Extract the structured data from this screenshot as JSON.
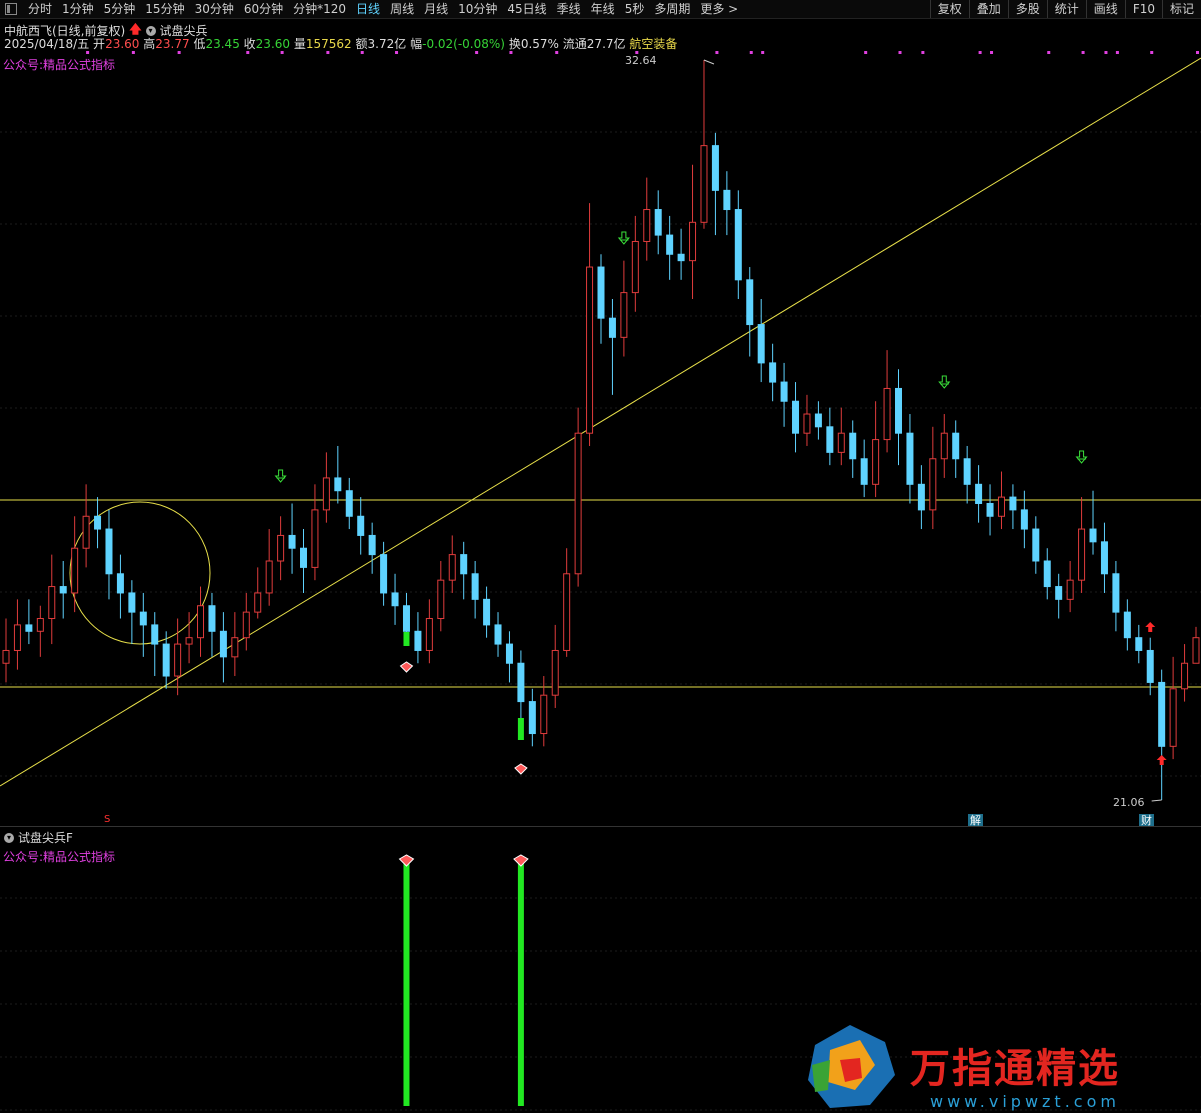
{
  "toolbar": {
    "tabs": [
      "分时",
      "1分钟",
      "5分钟",
      "15分钟",
      "30分钟",
      "60分钟",
      "分钟*120",
      "日线",
      "周线",
      "月线",
      "10分钟",
      "45日线",
      "季线",
      "年线",
      "5秒",
      "多周期",
      "更多 >"
    ],
    "active_index": 7,
    "right_buttons": [
      "复权",
      "叠加",
      "多股",
      "统计",
      "画线",
      "F10",
      "标记"
    ]
  },
  "header": {
    "stock_title": "中航西飞(日线,前复权)",
    "indicator_name": "试盘尖兵"
  },
  "quote": {
    "date": "2025/04/18/五",
    "open_label": "开",
    "open": "23.60",
    "high_label": "高",
    "high": "23.77",
    "low_label": "低",
    "low": "23.45",
    "close_label": "收",
    "close": "23.60",
    "volume_label": "量",
    "volume": "157562",
    "amount_label": "额",
    "amount": "3.72亿",
    "change_label": "幅",
    "change": "-0.02(-0.08%)",
    "turnover_label": "换",
    "turnover": "0.57%",
    "float_label": "流通",
    "float": "27.7亿",
    "sector": "航空装备"
  },
  "main_panel": {
    "formula_label": "公众号:精品公式指标",
    "high_price_label": "32.64",
    "low_price_label": "21.06",
    "badge_jie": "解",
    "badge_cai": "财",
    "s_marker": "S"
  },
  "sub_panel": {
    "title": "试盘尖兵F",
    "formula_label": "公众号:精品公式指标"
  },
  "watermark": {
    "title": "万指通精选",
    "url": "www.vipwzt.com"
  },
  "colors": {
    "up": "#e03c3c",
    "down": "#5fd3ff",
    "trend_line": "#e8e04a",
    "signal_green": "#22e822",
    "marker_magenta": "#e040e0"
  },
  "chart_data": {
    "type": "candlestick",
    "price_range": [
      21.06,
      32.64
    ],
    "candles": [
      [
        23.2,
        23.4,
        23.9,
        22.9
      ],
      [
        23.4,
        23.8,
        24.2,
        23.1
      ],
      [
        23.8,
        23.7,
        24.2,
        23.5
      ],
      [
        23.7,
        23.9,
        24.1,
        23.3
      ],
      [
        23.9,
        24.4,
        24.9,
        23.5
      ],
      [
        24.4,
        24.3,
        24.8,
        23.9
      ],
      [
        24.3,
        25.0,
        25.5,
        24.0
      ],
      [
        25.0,
        25.5,
        26.0,
        24.7
      ],
      [
        25.5,
        25.3,
        25.8,
        25.0
      ],
      [
        25.3,
        24.6,
        25.6,
        24.2
      ],
      [
        24.6,
        24.3,
        24.9,
        23.9
      ],
      [
        24.3,
        24.0,
        24.5,
        23.5
      ],
      [
        24.0,
        23.8,
        24.3,
        23.3
      ],
      [
        23.8,
        23.5,
        24.0,
        23.0
      ],
      [
        23.5,
        23.0,
        23.7,
        22.8
      ],
      [
        23.0,
        23.5,
        23.9,
        22.7
      ],
      [
        23.5,
        23.6,
        24.0,
        23.2
      ],
      [
        23.6,
        24.1,
        24.4,
        23.3
      ],
      [
        24.1,
        23.7,
        24.3,
        23.3
      ],
      [
        23.7,
        23.3,
        24.0,
        22.9
      ],
      [
        23.3,
        23.6,
        24.0,
        23.0
      ],
      [
        23.6,
        24.0,
        24.3,
        23.4
      ],
      [
        24.0,
        24.3,
        24.7,
        23.9
      ],
      [
        24.3,
        24.8,
        25.3,
        24.1
      ],
      [
        24.8,
        25.2,
        25.5,
        24.5
      ],
      [
        25.2,
        25.0,
        25.7,
        24.6
      ],
      [
        25.0,
        24.7,
        25.3,
        24.3
      ],
      [
        24.7,
        25.6,
        26.0,
        24.5
      ],
      [
        25.6,
        26.1,
        26.5,
        25.4
      ],
      [
        26.1,
        25.9,
        26.6,
        25.7
      ],
      [
        25.9,
        25.5,
        26.1,
        25.3
      ],
      [
        25.5,
        25.2,
        25.8,
        24.9
      ],
      [
        25.2,
        24.9,
        25.4,
        24.6
      ],
      [
        24.9,
        24.3,
        25.1,
        24.1
      ],
      [
        24.3,
        24.1,
        24.6,
        23.8
      ],
      [
        24.1,
        23.7,
        24.3,
        23.5
      ],
      [
        23.7,
        23.4,
        24.0,
        23.2
      ],
      [
        23.4,
        23.9,
        24.2,
        23.2
      ],
      [
        23.9,
        24.5,
        24.8,
        23.7
      ],
      [
        24.5,
        24.9,
        25.2,
        24.3
      ],
      [
        24.9,
        24.6,
        25.1,
        24.2
      ],
      [
        24.6,
        24.2,
        24.8,
        23.9
      ],
      [
        24.2,
        23.8,
        24.4,
        23.6
      ],
      [
        23.8,
        23.5,
        24.0,
        23.3
      ],
      [
        23.5,
        23.2,
        23.7,
        22.9
      ],
      [
        23.2,
        22.6,
        23.4,
        22.1
      ],
      [
        22.6,
        22.1,
        22.8,
        21.9
      ],
      [
        22.1,
        22.7,
        23.0,
        21.9
      ],
      [
        22.7,
        23.4,
        23.8,
        22.5
      ],
      [
        23.4,
        24.6,
        25.0,
        23.3
      ],
      [
        24.6,
        26.8,
        27.2,
        24.4
      ],
      [
        26.8,
        29.4,
        30.4,
        26.6
      ],
      [
        29.4,
        28.6,
        29.6,
        28.2
      ],
      [
        28.6,
        28.3,
        28.9,
        27.4
      ],
      [
        28.3,
        29.0,
        29.5,
        28.0
      ],
      [
        29.0,
        29.8,
        30.2,
        28.7
      ],
      [
        29.8,
        30.3,
        30.8,
        29.5
      ],
      [
        30.3,
        29.9,
        30.6,
        29.6
      ],
      [
        29.9,
        29.6,
        30.2,
        29.2
      ],
      [
        29.6,
        29.5,
        30.0,
        29.2
      ],
      [
        29.5,
        30.1,
        31.0,
        28.9
      ],
      [
        30.1,
        31.3,
        32.64,
        30.0
      ],
      [
        31.3,
        30.6,
        31.5,
        29.9
      ],
      [
        30.6,
        30.3,
        30.9,
        29.9
      ],
      [
        30.3,
        29.2,
        30.6,
        28.9
      ],
      [
        29.2,
        28.5,
        29.4,
        28.0
      ],
      [
        28.5,
        27.9,
        28.9,
        27.6
      ],
      [
        27.9,
        27.6,
        28.2,
        27.3
      ],
      [
        27.6,
        27.3,
        27.9,
        26.9
      ],
      [
        27.3,
        26.8,
        27.6,
        26.5
      ],
      [
        26.8,
        27.1,
        27.4,
        26.6
      ],
      [
        27.1,
        26.9,
        27.3,
        26.7
      ],
      [
        26.9,
        26.5,
        27.2,
        26.3
      ],
      [
        26.5,
        26.8,
        27.2,
        26.3
      ],
      [
        26.8,
        26.4,
        27.0,
        26.1
      ],
      [
        26.4,
        26.0,
        26.7,
        25.8
      ],
      [
        26.0,
        26.7,
        27.3,
        25.8
      ],
      [
        26.7,
        27.5,
        28.1,
        26.5
      ],
      [
        27.5,
        26.8,
        27.8,
        26.3
      ],
      [
        26.8,
        26.0,
        27.1,
        25.7
      ],
      [
        26.0,
        25.6,
        26.3,
        25.3
      ],
      [
        25.6,
        26.4,
        26.9,
        25.3
      ],
      [
        26.4,
        26.8,
        27.1,
        26.1
      ],
      [
        26.8,
        26.4,
        27.0,
        26.1
      ],
      [
        26.4,
        26.0,
        26.6,
        25.7
      ],
      [
        26.0,
        25.7,
        26.3,
        25.4
      ],
      [
        25.7,
        25.5,
        26.0,
        25.2
      ],
      [
        25.5,
        25.8,
        26.2,
        25.3
      ],
      [
        25.8,
        25.6,
        26.0,
        25.3
      ],
      [
        25.6,
        25.3,
        25.9,
        25.0
      ],
      [
        25.3,
        24.8,
        25.5,
        24.6
      ],
      [
        24.8,
        24.4,
        25.0,
        24.2
      ],
      [
        24.4,
        24.2,
        24.6,
        23.9
      ],
      [
        24.2,
        24.5,
        24.8,
        24.0
      ],
      [
        24.5,
        25.3,
        25.8,
        24.3
      ],
      [
        25.3,
        25.1,
        25.9,
        24.9
      ],
      [
        25.1,
        24.6,
        25.4,
        24.3
      ],
      [
        24.6,
        24.0,
        24.8,
        23.7
      ],
      [
        24.0,
        23.6,
        24.2,
        23.4
      ],
      [
        23.6,
        23.4,
        23.8,
        23.2
      ],
      [
        23.4,
        22.9,
        23.6,
        22.7
      ],
      [
        22.9,
        21.9,
        23.1,
        21.06
      ],
      [
        21.9,
        22.8,
        23.3,
        21.7
      ],
      [
        22.8,
        23.2,
        23.5,
        22.6
      ],
      [
        23.2,
        23.6,
        23.77,
        23.45
      ]
    ],
    "trend_lines": "ascending trendline plus two horizontal levels and one circle annotation",
    "signals_sub_panel": "two green signal bars"
  }
}
